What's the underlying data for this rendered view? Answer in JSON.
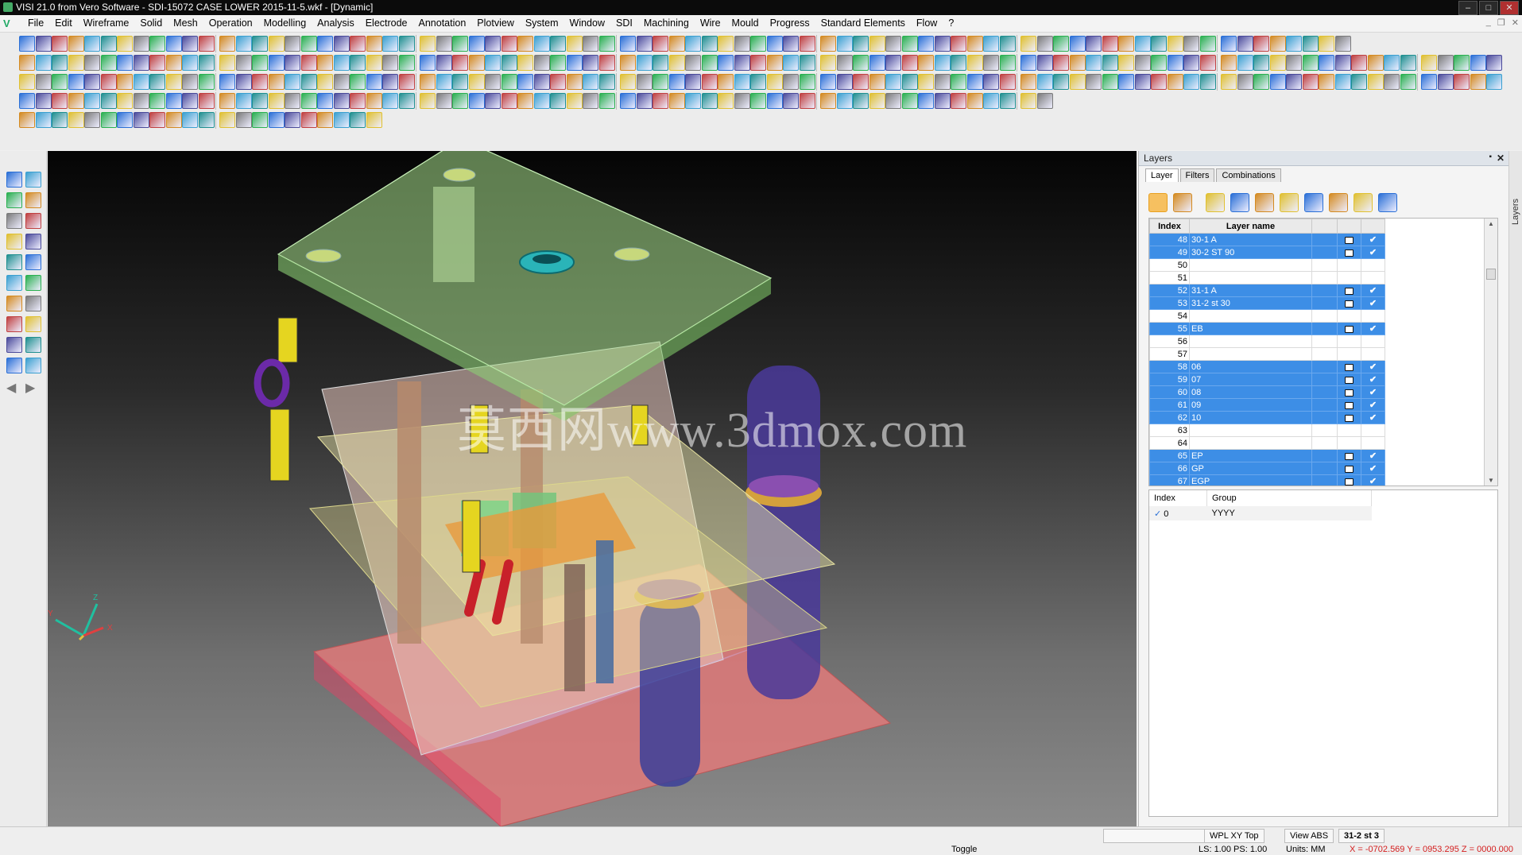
{
  "window": {
    "title": "VISI 21.0 from Vero Software - SDI-15072 CASE LOWER 2015-11-5.wkf - [Dynamic]",
    "controls": [
      "–",
      "□",
      "✕"
    ]
  },
  "menu": {
    "items": [
      "File",
      "Edit",
      "Wireframe",
      "Solid",
      "Mesh",
      "Operation",
      "Modelling",
      "Analysis",
      "Electrode",
      "Annotation",
      "Plotview",
      "System",
      "Window",
      "SDI",
      "Machining",
      "Wire",
      "Mould",
      "Progress",
      "Standard Elements",
      "Flow",
      "?"
    ],
    "mdi_controls": [
      "_",
      "❐",
      "✕"
    ]
  },
  "viewport": {
    "watermark": "莫西网www.3dmox.com",
    "axis_labels": {
      "x": "X",
      "y": "Y",
      "z": "Z"
    }
  },
  "layers_panel": {
    "title": "Layers",
    "tabs": [
      "Layer",
      "Filters",
      "Combinations"
    ],
    "active_tab": "Layer",
    "columns": {
      "index": "Index",
      "name": "Layer name"
    },
    "rows": [
      {
        "index": "48",
        "name": "30-1 A",
        "selected": true,
        "locked": true,
        "check": "✔"
      },
      {
        "index": "49",
        "name": "30-2 ST 90",
        "selected": true,
        "locked": true,
        "check": "✔"
      },
      {
        "index": "50",
        "name": "",
        "selected": false,
        "locked": false,
        "check": ""
      },
      {
        "index": "51",
        "name": "",
        "selected": false,
        "locked": false,
        "check": ""
      },
      {
        "index": "52",
        "name": "31-1 A",
        "selected": true,
        "locked": true,
        "check": "✔"
      },
      {
        "index": "53",
        "name": "31-2 st 30",
        "selected": true,
        "locked": true,
        "check": "✔"
      },
      {
        "index": "54",
        "name": "",
        "selected": false,
        "locked": false,
        "check": ""
      },
      {
        "index": "55",
        "name": "EB",
        "selected": true,
        "locked": true,
        "check": "✔"
      },
      {
        "index": "56",
        "name": "",
        "selected": false,
        "locked": false,
        "check": ""
      },
      {
        "index": "57",
        "name": "",
        "selected": false,
        "locked": false,
        "check": ""
      },
      {
        "index": "58",
        "name": "06",
        "selected": true,
        "locked": true,
        "check": "✔"
      },
      {
        "index": "59",
        "name": "07",
        "selected": true,
        "locked": true,
        "check": "✔"
      },
      {
        "index": "60",
        "name": "08",
        "selected": true,
        "locked": true,
        "check": "✔"
      },
      {
        "index": "61",
        "name": "09",
        "selected": true,
        "locked": true,
        "check": "✔"
      },
      {
        "index": "62",
        "name": "10",
        "selected": true,
        "locked": true,
        "check": "✔"
      },
      {
        "index": "63",
        "name": "",
        "selected": false,
        "locked": false,
        "check": ""
      },
      {
        "index": "64",
        "name": "",
        "selected": false,
        "locked": false,
        "check": ""
      },
      {
        "index": "65",
        "name": "EP",
        "selected": true,
        "locked": true,
        "check": "✔"
      },
      {
        "index": "66",
        "name": "GP",
        "selected": true,
        "locked": true,
        "check": "✔"
      },
      {
        "index": "67",
        "name": "EGP",
        "selected": true,
        "locked": true,
        "check": "✔"
      }
    ],
    "group_columns": {
      "index": "Index",
      "group": "Group"
    },
    "groups": [
      {
        "check": "✓",
        "index": "0",
        "group": "YYYY"
      }
    ],
    "side_tab": "Layers"
  },
  "statusbar": {
    "toggle": "Toggle",
    "ls_ps": "LS: 1.00 PS: 1.00",
    "units": "Units: MM",
    "coords": "X = -0702.569 Y = 0953.295 Z = 0000.000",
    "wpl": "WPL XY Top",
    "view": "View ABS",
    "layer": "31-2 st 3"
  },
  "colors": {
    "selection": "#3d8ee6",
    "check": "#17a820",
    "coords_text": "#d42020"
  }
}
